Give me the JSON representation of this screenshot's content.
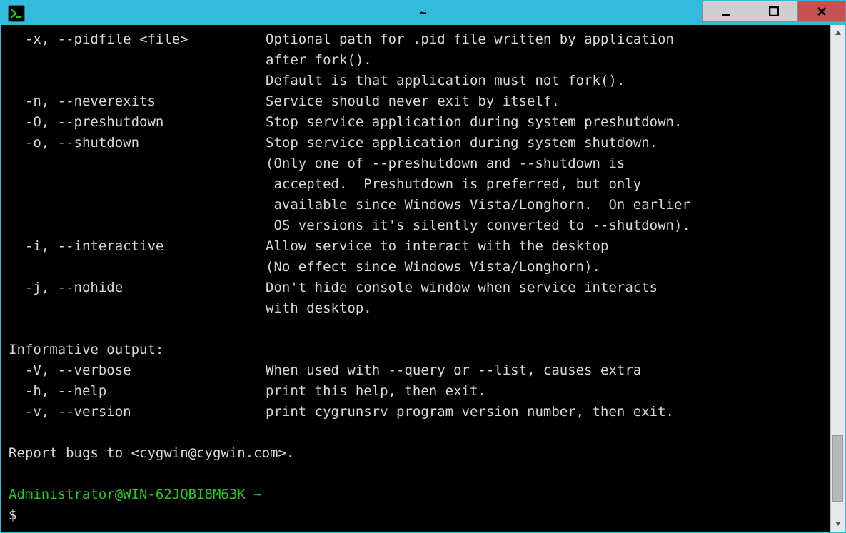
{
  "window": {
    "title": "~"
  },
  "output": {
    "options": [
      {
        "flag": "  -x, --pidfile <file>",
        "desc": "Optional path for .pid file written by application",
        "cont": [
          "after fork().",
          "Default is that application must not fork()."
        ]
      },
      {
        "flag": "  -n, --neverexits",
        "desc": "Service should never exit by itself.",
        "cont": []
      },
      {
        "flag": "  -O, --preshutdown",
        "desc": "Stop service application during system preshutdown.",
        "cont": []
      },
      {
        "flag": "  -o, --shutdown",
        "desc": "Stop service application during system shutdown.",
        "cont": [
          "(Only one of --preshutdown and --shutdown is",
          " accepted.  Preshutdown is preferred, but only",
          " available since Windows Vista/Longhorn.  On earlier",
          " OS versions it's silently converted to --shutdown)."
        ]
      },
      {
        "flag": "  -i, --interactive",
        "desc": "Allow service to interact with the desktop",
        "cont": [
          "(No effect since Windows Vista/Longhorn)."
        ]
      },
      {
        "flag": "  -j, --nohide",
        "desc": "Don't hide console window when service interacts",
        "cont": [
          "with desktop."
        ]
      }
    ],
    "section_header": "Informative output:",
    "info_options": [
      {
        "flag": "  -V, --verbose",
        "desc": "When used with --query or --list, causes extra",
        "cont": []
      },
      {
        "flag": "  -h, --help",
        "desc": "print this help, then exit.",
        "cont": []
      },
      {
        "flag": "  -v, --version",
        "desc": "print cygrunsrv program version number, then exit.",
        "cont": []
      }
    ],
    "footer": "Report bugs to <cygwin@cygwin.com>."
  },
  "prompt": {
    "user_host": "Administrator@WIN-62JQBI8M63K",
    "path": "~",
    "symbol": "$"
  },
  "icons": {
    "minimize": "—",
    "maximize": "◻",
    "close": "✕",
    "scroll_up": "▴",
    "scroll_down": "▾"
  }
}
